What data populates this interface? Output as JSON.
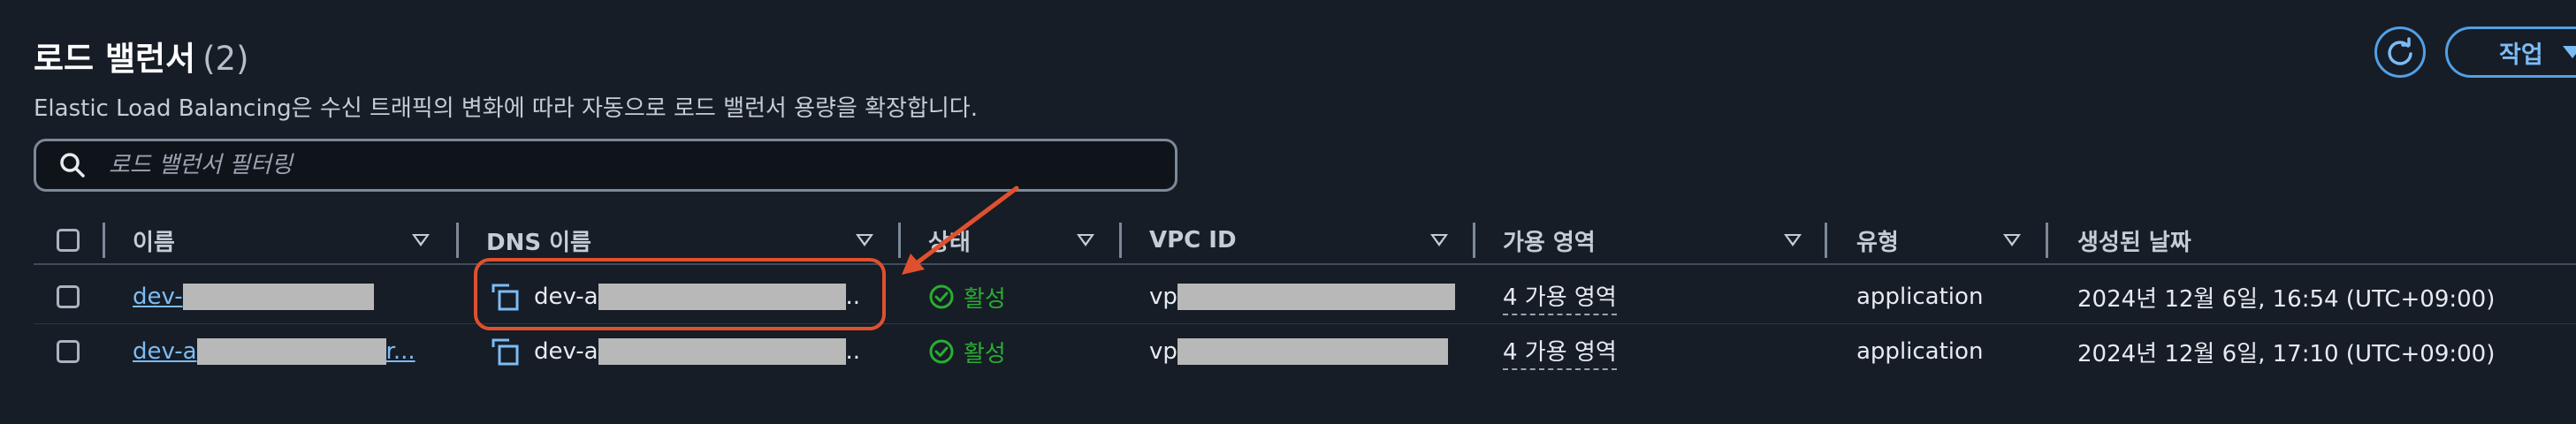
{
  "header": {
    "title": "로드 밸런서",
    "count": "(2)",
    "description": "Elastic Load Balancing은 수신 트래픽의 변화에 따라 자동으로 로드 밸런서 용량을 확장합니다.",
    "refresh_icon": "refresh-icon",
    "action_label": "작업"
  },
  "search": {
    "placeholder": "로드 밸런서 필터링",
    "icon": "search-icon"
  },
  "table": {
    "columns": [
      "이름",
      "DNS 이름",
      "상태",
      "VPC ID",
      "가용 영역",
      "유형",
      "생성된 날짜"
    ],
    "rows": [
      {
        "name": "dev-",
        "dns": "dev-a",
        "dns_suffix": "..",
        "status": "활성",
        "vpc": "vp",
        "az": "4 가용 영역",
        "type": "application",
        "created": "2024년 12월 6일, 16:54 (UTC+09:00)"
      },
      {
        "name": "dev-a",
        "name_suffix": "r...",
        "dns": "dev-a",
        "dns_suffix": "..",
        "status": "활성",
        "vpc": "vp",
        "az": "4 가용 영역",
        "type": "application",
        "created": "2024년 12월 6일, 17:10 (UTC+09:00)"
      }
    ]
  },
  "colors": {
    "background": "#161d26",
    "link": "#7cbcf5",
    "accent": "#539fe5",
    "success": "#29ad32",
    "annotation": "#e0502e"
  }
}
